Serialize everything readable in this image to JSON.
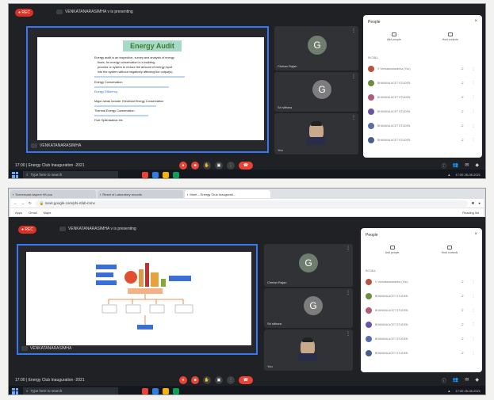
{
  "meet": {
    "rec_label": "REC",
    "presenter_name": "VENKATANARASIMHA",
    "presenting_text": "VENKATANARASIMHA v is presenting",
    "meeting_name": "Energy Club Inauguration -2021",
    "time_label": "17:00",
    "participants": [
      {
        "name": "Chetan Rajan",
        "initial": "G",
        "avatar_color": "#6f7d6f"
      },
      {
        "name": "Sri sithara",
        "initial": "G",
        "avatar_color": "#7d7d7d"
      },
      {
        "name": "You",
        "initial": "",
        "avatar_color": "#303236"
      }
    ]
  },
  "slide1": {
    "title": "Energy Audit",
    "bullets": [
      "Energy audit is an inspection, survey and analysis of energy",
      "flows, for energy conservation in a building,",
      "process or system to reduce the amount of energy input",
      "into the system without negatively affecting the output(s)",
      "Energy Conservation",
      "Energy Efficiency",
      "Major areas include: Electrical Energy Conservation",
      "Thermal Energy Conservation",
      "Fuel Optimisation etc"
    ]
  },
  "people_panel": {
    "title": "People",
    "close": "×",
    "tabs": [
      "Add people",
      "Host controls"
    ],
    "in_call_label": "IN CALL",
    "rows": [
      {
        "name": "V Venkatanarasimha (You)",
        "color": "#b7553f"
      },
      {
        "name": "BHAVANA ACET STUDEN",
        "color": "#6b8f3e"
      },
      {
        "name": "BHAVANA ACET STUDEN",
        "color": "#b45b7a"
      },
      {
        "name": "BHAVANA ACET STUDEN",
        "color": "#6a54a8"
      },
      {
        "name": "BHAVANA ACET STUDEN",
        "color": "#5b6ea8"
      },
      {
        "name": "BHAVANA ACET STUDEN",
        "color": "#4a5d8e"
      }
    ]
  },
  "taskbar": {
    "search_placeholder": "Type here to search",
    "clock": "17:00",
    "date": "26-08-2021"
  },
  "browser": {
    "tabs": [
      "Screencast Aspect Hit you",
      "Reset of Laboratory records",
      "Meet – Energy Club Inaugurati..."
    ],
    "url": "meet.google.com/pfs-nfab-mmx",
    "bookmarks": [
      "Apps",
      "Gmail",
      "Maps"
    ],
    "reading_list": "Reading list"
  },
  "icons": {
    "mic": "microphone-icon",
    "cam": "camera-icon",
    "hand": "raise-hand-icon",
    "present": "present-icon",
    "more": "more-options-icon",
    "end": "end-call-icon"
  },
  "colors": {
    "accent": "#3478f6",
    "end_call": "#ea4335",
    "rec": "#d93025",
    "slide_title": "#3a7d2a"
  }
}
